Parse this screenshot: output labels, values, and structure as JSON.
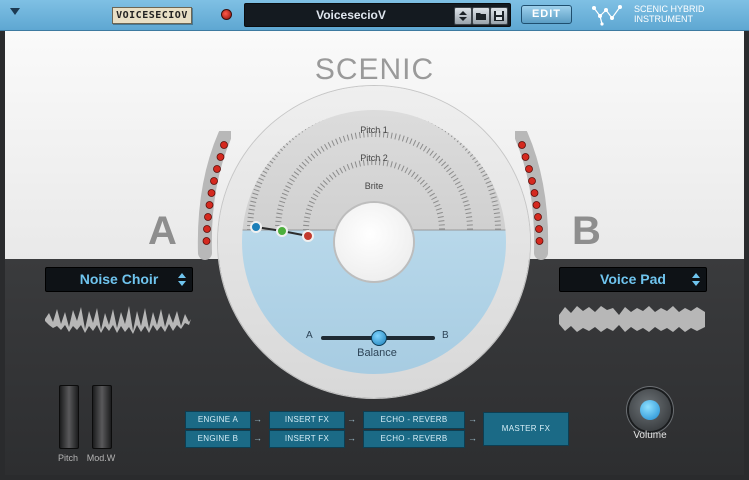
{
  "topbar": {
    "patch_tag": "VOICESECIOV",
    "preset_name": "VoicesecioV",
    "edit_label": "EDIT",
    "brand_line1": "SCENIC HYBRID",
    "brand_line2": "INSTRUMENT"
  },
  "title": "SCENIC",
  "sides": {
    "left_letter": "A",
    "right_letter": "B"
  },
  "dial": {
    "rings": [
      "Pitch 1",
      "Pitch 2",
      "Brite"
    ],
    "balance": {
      "label": "Balance",
      "left": "A",
      "right": "B",
      "value": 0.5
    }
  },
  "engine_a": {
    "name": "Noise Choir"
  },
  "engine_b": {
    "name": "Voice Pad"
  },
  "wheels": {
    "pitch_label": "Pitch",
    "mod_label": "Mod.W"
  },
  "fx": {
    "engine_a": "ENGINE A",
    "engine_b": "ENGINE B",
    "insert_a": "INSERT FX",
    "insert_b": "INSERT FX",
    "echo_a": "ECHO - REVERB",
    "echo_b": "ECHO - REVERB",
    "master": "MASTER FX"
  },
  "volume": {
    "label": "Volume"
  },
  "colors": {
    "accent": "#5ea7d2",
    "display_text": "#6fc4ee",
    "led": "#d4291f"
  }
}
